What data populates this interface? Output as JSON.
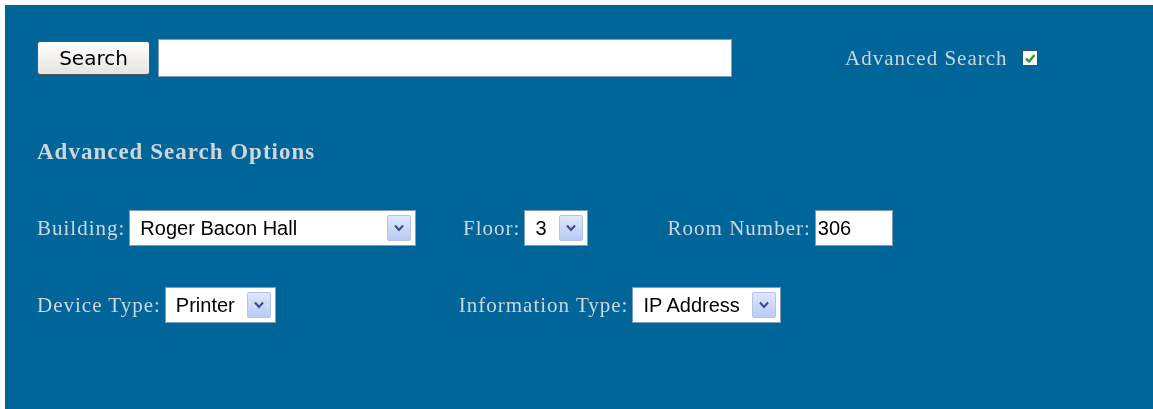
{
  "search": {
    "button": "Search"
  },
  "advanced_search": {
    "label": "Advanced Search",
    "checked": true
  },
  "options": {
    "title": "Advanced Search Options",
    "rows": [
      [
        {
          "label": "Building:",
          "kind": "select",
          "value": "Roger Bacon Hall"
        },
        {
          "label": "Floor:",
          "kind": "select",
          "value": "3"
        },
        {
          "label": "Room Number:",
          "kind": "text",
          "value": "306"
        }
      ],
      [
        {
          "label": "Device Type:",
          "kind": "select",
          "value": "Printer"
        },
        {
          "label": "Information Type:",
          "kind": "select",
          "value": "IP Address"
        }
      ]
    ]
  }
}
